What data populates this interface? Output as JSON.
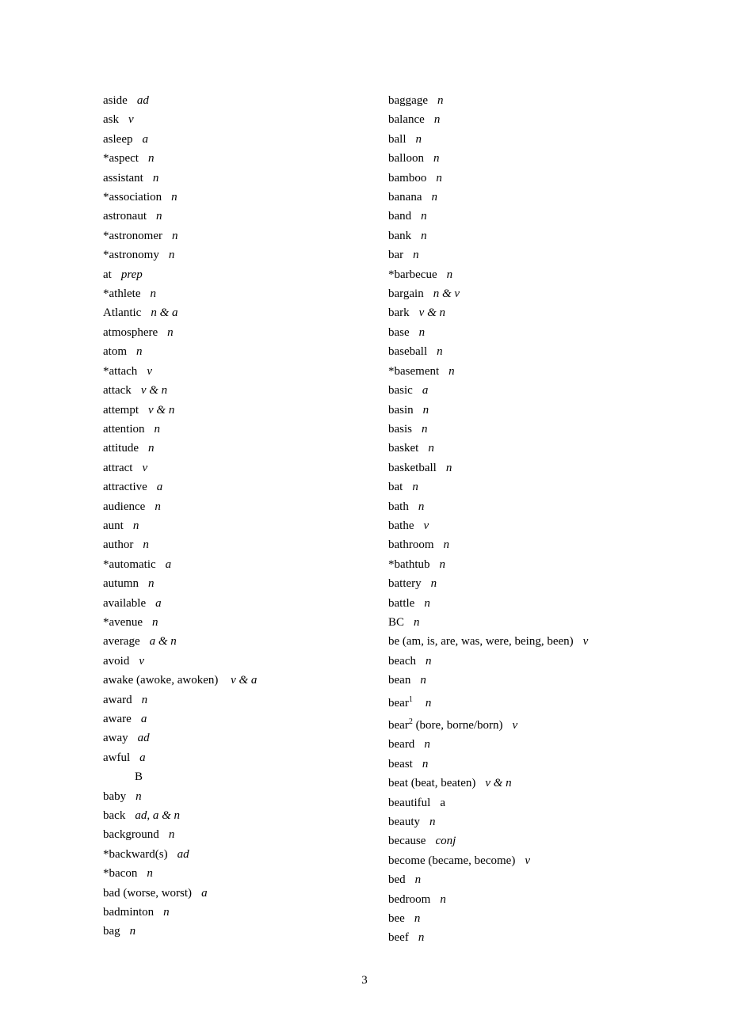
{
  "pageNumber": "3",
  "sectionHeading": "B",
  "col1": [
    {
      "word": "aside",
      "pos": "ad"
    },
    {
      "word": "ask",
      "pos": "v"
    },
    {
      "word": "asleep",
      "pos": "a"
    },
    {
      "word": "*aspect",
      "pos": "n"
    },
    {
      "word": "assistant",
      "pos": "n"
    },
    {
      "word": "*association",
      "pos": "n"
    },
    {
      "word": "astronaut",
      "pos": "n"
    },
    {
      "word": "*astronomer",
      "pos": "n"
    },
    {
      "word": "*astronomy",
      "pos": "n"
    },
    {
      "word": "at",
      "pos": "prep"
    },
    {
      "word": "*athlete",
      "pos": "n"
    },
    {
      "word": "Atlantic",
      "pos": "n & a"
    },
    {
      "word": "atmosphere",
      "pos": "n"
    },
    {
      "word": "atom",
      "pos": "n"
    },
    {
      "word": "*attach",
      "pos": "v"
    },
    {
      "word": "attack",
      "pos": "v & n"
    },
    {
      "word": "attempt",
      "pos": "v & n"
    },
    {
      "word": "attention",
      "pos": "n"
    },
    {
      "word": "attitude",
      "pos": "n"
    },
    {
      "word": "attract",
      "pos": "v"
    },
    {
      "word": "attractive",
      "pos": "a"
    },
    {
      "word": "audience",
      "pos": "n"
    },
    {
      "word": "aunt",
      "pos": "n"
    },
    {
      "word": "author",
      "pos": "n"
    },
    {
      "word": "*automatic",
      "pos": "a"
    },
    {
      "word": "autumn",
      "pos": "n"
    },
    {
      "word": "available",
      "pos": "a"
    },
    {
      "word": "*avenue",
      "pos": "n"
    },
    {
      "word": "average",
      "pos": "a & n"
    },
    {
      "word": "avoid",
      "pos": "v"
    },
    {
      "word": "awake (awoke, awoken) ",
      "pos": "v & a"
    },
    {
      "word": "award",
      "pos": "n"
    },
    {
      "word": "aware",
      "pos": "a"
    },
    {
      "word": "away",
      "pos": "ad"
    },
    {
      "word": "awful",
      "pos": "a"
    }
  ],
  "col1b": [
    {
      "word": "baby",
      "pos": "n"
    },
    {
      "word": "back",
      "pos": "ad, a & n"
    },
    {
      "word": "background",
      "pos": "n"
    },
    {
      "word": "*backward(s)",
      "pos": "ad"
    },
    {
      "word": "*bacon",
      "pos": "n"
    },
    {
      "word": "bad (worse,   worst)",
      "pos": "a"
    },
    {
      "word": "badminton",
      "pos": "n"
    },
    {
      "word": "bag",
      "pos": "n"
    }
  ],
  "col2": [
    {
      "word": "baggage",
      "pos": "n"
    },
    {
      "word": "balance",
      "pos": "n"
    },
    {
      "word": "ball",
      "pos": "n"
    },
    {
      "word": "balloon",
      "pos": "n"
    },
    {
      "word": "bamboo",
      "pos": "n"
    },
    {
      "word": "banana",
      "pos": "n"
    },
    {
      "word": "band",
      "pos": "n"
    },
    {
      "word": "bank",
      "pos": "n"
    },
    {
      "word": "bar",
      "pos": "n"
    },
    {
      "word": "*barbecue",
      "pos": "n"
    },
    {
      "word": "bargain",
      "pos": "n & v"
    },
    {
      "word": "bark",
      "pos": "v & n"
    },
    {
      "word": "base",
      "pos": "n"
    },
    {
      "word": "baseball",
      "pos": "n"
    },
    {
      "word": "*basement",
      "pos": "n"
    },
    {
      "word": "basic",
      "pos": "a"
    },
    {
      "word": "basin",
      "pos": "n"
    },
    {
      "word": "basis",
      "pos": "n"
    },
    {
      "word": "basket",
      "pos": "n"
    },
    {
      "word": "basketball",
      "pos": "n"
    },
    {
      "word": "bat",
      "pos": "n"
    },
    {
      "word": "bath",
      "pos": "n"
    },
    {
      "word": "bathe",
      "pos": "v"
    },
    {
      "word": "bathroom",
      "pos": "n"
    },
    {
      "word": "*bathtub",
      "pos": "n"
    },
    {
      "word": "battery",
      "pos": "n"
    },
    {
      "word": "battle",
      "pos": "n"
    },
    {
      "word": "BC",
      "pos": "n"
    },
    {
      "word": "be (am, is, are, was, were, being, been)",
      "pos": "v"
    },
    {
      "word": "beach",
      "pos": "n"
    },
    {
      "word": "bean",
      "pos": "n"
    },
    {
      "word": "bear",
      "sup": "1",
      "pos": "n",
      "posGap": "16px"
    },
    {
      "word": "bear",
      "sup": "2",
      "extra": " (bore, borne/born)",
      "pos": "v"
    },
    {
      "word": "beard",
      "pos": "n"
    },
    {
      "word": "beast",
      "pos": "n"
    },
    {
      "word": "beat (beat, beaten)",
      "pos": "v & n"
    },
    {
      "word": "beautiful",
      "pos": "a",
      "posItalic": false
    },
    {
      "word": "beauty",
      "pos": "n"
    },
    {
      "word": "because",
      "pos": "conj"
    },
    {
      "word": "become (became, become)",
      "pos": "v"
    },
    {
      "word": "bed",
      "pos": "n"
    },
    {
      "word": "bedroom",
      "pos": "n"
    },
    {
      "word": "bee",
      "pos": "n"
    },
    {
      "word": "beef",
      "pos": "n"
    }
  ]
}
